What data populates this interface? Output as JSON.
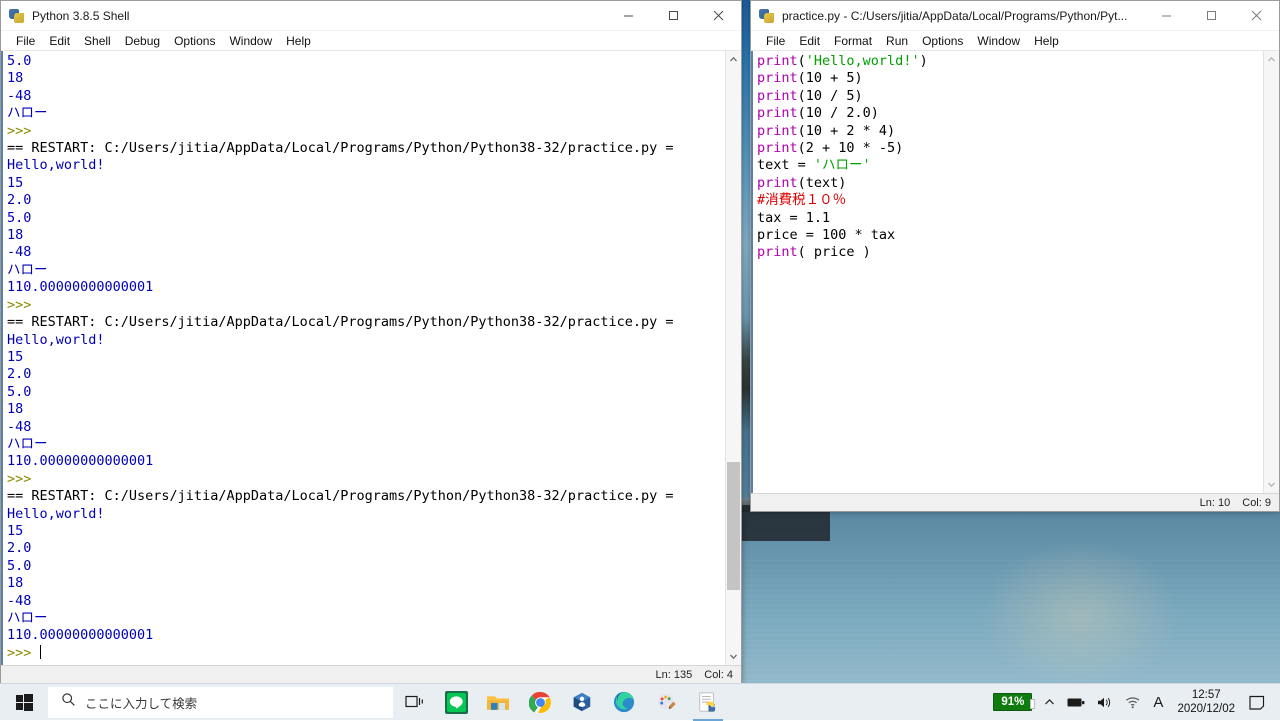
{
  "shell_window": {
    "title": "Python 3.8.5 Shell",
    "icon": "python-idle-icon",
    "menus": [
      "File",
      "Edit",
      "Shell",
      "Debug",
      "Options",
      "Window",
      "Help"
    ],
    "window_controls": {
      "minimize": "minimize-icon",
      "maximize": "maximize-icon",
      "close": "close-icon"
    },
    "status": {
      "line": "Ln: 135",
      "col": "Col: 4"
    },
    "output_lines": [
      {
        "text": "5.0",
        "kind": "out"
      },
      {
        "text": "18",
        "kind": "out"
      },
      {
        "text": "-48",
        "kind": "out"
      },
      {
        "text": "ハロー",
        "kind": "out"
      },
      {
        "text": ">>> ",
        "kind": "prompt"
      },
      {
        "text": "== RESTART: C:/Users/jitia/AppData/Local/Programs/Python/Python38-32/practice.py =",
        "kind": "restart"
      },
      {
        "text": "Hello,world!",
        "kind": "out"
      },
      {
        "text": "15",
        "kind": "out"
      },
      {
        "text": "2.0",
        "kind": "out"
      },
      {
        "text": "5.0",
        "kind": "out"
      },
      {
        "text": "18",
        "kind": "out"
      },
      {
        "text": "-48",
        "kind": "out"
      },
      {
        "text": "ハロー",
        "kind": "out"
      },
      {
        "text": "110.00000000000001",
        "kind": "out"
      },
      {
        "text": ">>> ",
        "kind": "prompt"
      },
      {
        "text": "== RESTART: C:/Users/jitia/AppData/Local/Programs/Python/Python38-32/practice.py =",
        "kind": "restart"
      },
      {
        "text": "Hello,world!",
        "kind": "out"
      },
      {
        "text": "15",
        "kind": "out"
      },
      {
        "text": "2.0",
        "kind": "out"
      },
      {
        "text": "5.0",
        "kind": "out"
      },
      {
        "text": "18",
        "kind": "out"
      },
      {
        "text": "-48",
        "kind": "out"
      },
      {
        "text": "ハロー",
        "kind": "out"
      },
      {
        "text": "110.00000000000001",
        "kind": "out"
      },
      {
        "text": ">>> ",
        "kind": "prompt"
      },
      {
        "text": "== RESTART: C:/Users/jitia/AppData/Local/Programs/Python/Python38-32/practice.py =",
        "kind": "restart"
      },
      {
        "text": "Hello,world!",
        "kind": "out"
      },
      {
        "text": "15",
        "kind": "out"
      },
      {
        "text": "2.0",
        "kind": "out"
      },
      {
        "text": "5.0",
        "kind": "out"
      },
      {
        "text": "18",
        "kind": "out"
      },
      {
        "text": "-48",
        "kind": "out"
      },
      {
        "text": "ハロー",
        "kind": "out"
      },
      {
        "text": "110.00000000000001",
        "kind": "out"
      },
      {
        "text": ">>> ",
        "kind": "prompt-cursor"
      }
    ]
  },
  "editor_window": {
    "title": "practice.py - C:/Users/jitia/AppData/Local/Programs/Python/Pyt...",
    "icon": "python-idle-icon",
    "menus": [
      "File",
      "Edit",
      "Format",
      "Run",
      "Options",
      "Window",
      "Help"
    ],
    "window_controls": {
      "minimize": "minimize-icon",
      "maximize": "maximize-icon",
      "close": "close-icon"
    },
    "status": {
      "line": "Ln: 10",
      "col": "Col: 9"
    },
    "code_lines": [
      [
        {
          "t": "print",
          "c": "kw"
        },
        {
          "t": "(",
          "c": "plain"
        },
        {
          "t": "'Hello,world!'",
          "c": "str"
        },
        {
          "t": ")",
          "c": "plain"
        }
      ],
      [
        {
          "t": "print",
          "c": "kw"
        },
        {
          "t": "(10 + 5)",
          "c": "plain"
        }
      ],
      [
        {
          "t": "print",
          "c": "kw"
        },
        {
          "t": "(10 / 5)",
          "c": "plain"
        }
      ],
      [
        {
          "t": "print",
          "c": "kw"
        },
        {
          "t": "(10 / 2.0)",
          "c": "plain"
        }
      ],
      [
        {
          "t": "print",
          "c": "kw"
        },
        {
          "t": "(10 + 2 * 4)",
          "c": "plain"
        }
      ],
      [
        {
          "t": "print",
          "c": "kw"
        },
        {
          "t": "(2 + 10 * -5)",
          "c": "plain"
        }
      ],
      [
        {
          "t": "text = ",
          "c": "plain"
        },
        {
          "t": "'ハロー'",
          "c": "str"
        }
      ],
      [
        {
          "t": "print",
          "c": "kw"
        },
        {
          "t": "(text)",
          "c": "plain"
        }
      ],
      [
        {
          "t": "#消費税１０％",
          "c": "cmt"
        }
      ],
      [
        {
          "t": "tax = 1.1",
          "c": "plain"
        }
      ],
      [
        {
          "t": "price = 100 * tax",
          "c": "plain"
        }
      ],
      [
        {
          "t": "print",
          "c": "kw"
        },
        {
          "t": "( price )",
          "c": "plain"
        }
      ]
    ]
  },
  "taskbar": {
    "start": "windows-start-icon",
    "search_placeholder": "ここに入力して検索",
    "search_icon": "search-icon",
    "task_view": "task-view-icon",
    "apps": [
      {
        "name": "line-icon",
        "label": "LINE"
      },
      {
        "name": "file-explorer-icon",
        "label": "エクスプローラー"
      },
      {
        "name": "chrome-icon",
        "label": "Google Chrome"
      },
      {
        "name": "virtualbox-icon",
        "label": "VirtualBox"
      },
      {
        "name": "edge-icon",
        "label": "Microsoft Edge"
      },
      {
        "name": "paint-3d-icon",
        "label": "ペイント 3D"
      },
      {
        "name": "python-idle-icon",
        "label": "IDLE"
      }
    ],
    "tray": {
      "battery_percent": "91%",
      "battery_color": "#107c10",
      "show_hidden": "chevron-up-icon",
      "battery": "battery-icon",
      "volume": "volume-icon",
      "network": "wifi-icon",
      "ime": "A",
      "time": "12:57",
      "date": "2020/12/02",
      "notifications": "notification-icon"
    }
  },
  "colors": {
    "string_green": "#00a000",
    "keyword_purple": "#b000b0",
    "comment_red": "#dd0000",
    "output_blue": "#0000bb",
    "prompt_olive": "#8a8a00"
  }
}
